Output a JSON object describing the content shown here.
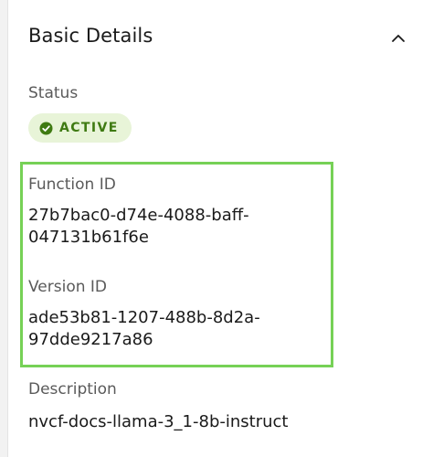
{
  "section": {
    "title": "Basic Details"
  },
  "status": {
    "label": "Status",
    "value": "ACTIVE"
  },
  "function_id": {
    "label": "Function ID",
    "line1": "27b7bac0-d74e-4088-baff-",
    "line2": "047131b61f6e"
  },
  "version_id": {
    "label": "Version ID",
    "line1": "ade53b81-1207-488b-8d2a-",
    "line2": "97dde9217a86"
  },
  "description": {
    "label": "Description",
    "value": "nvcf-docs-llama-3_1-8b-instruct"
  },
  "colors": {
    "highlight_border": "#76d156",
    "status_text": "#3f7a12",
    "status_background": "#e8f4d8"
  },
  "icons": {
    "collapse": "chevron-up-icon",
    "status": "check-circle-icon"
  }
}
